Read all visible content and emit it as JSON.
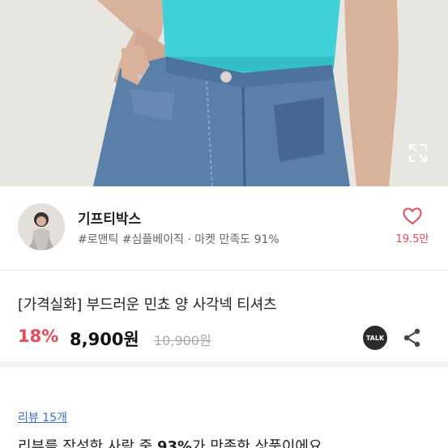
{
  "seller": {
    "name": "기프티박스",
    "tags": "#로맨틱 #심플베이직 · 마켓 만족도 91%",
    "like_count": "19.5만"
  },
  "product": {
    "title": "[가격실화] 부드러운 민쵸 양 사각넥 티셔츠",
    "discount": "18%",
    "price": "8,900원",
    "original_price": "10,900원",
    "talk_label": "TALK"
  },
  "review": {
    "link_label": "리뷰 15개",
    "summary_prefix": "리뷰를 작성한 사람 중 ",
    "summary_percent": "93%",
    "summary_suffix": "가 만족한 상품이에요"
  },
  "colors": {
    "accent": "#e74a5b",
    "link": "#3c6fc4",
    "shirt": "#3fd0d8",
    "denim": "#5a7fa8"
  },
  "icons": {
    "expand": "fullscreen-icon",
    "like": "heart-icon",
    "share": "share-icon",
    "talk": "kakaotalk-icon"
  }
}
